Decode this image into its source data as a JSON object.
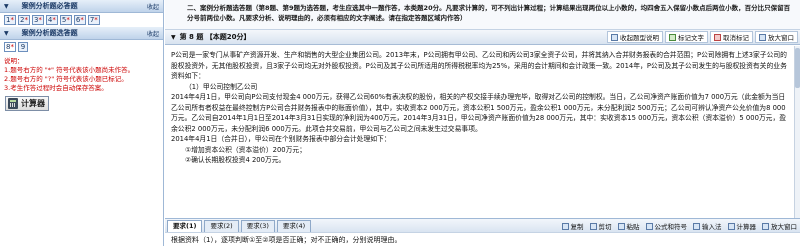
{
  "left": {
    "header1": {
      "label": "案例分析题必答题",
      "collapse": "收起"
    },
    "required_questions": [
      {
        "num": "1",
        "star": "*"
      },
      {
        "num": "2",
        "star": "*"
      },
      {
        "num": "3",
        "star": "*"
      },
      {
        "num": "4",
        "star": "*"
      },
      {
        "num": "5",
        "star": "*"
      },
      {
        "num": "6",
        "star": "*"
      },
      {
        "num": "7",
        "star": "*"
      }
    ],
    "header2": {
      "label": "案例分析题选答题",
      "collapse": "收起"
    },
    "optional_questions": [
      {
        "num": "8",
        "star": "*"
      },
      {
        "num": "9"
      }
    ],
    "notes": [
      "说明：",
      "1.题号右方的 \"*\" 符号代表该小题尚未作答。",
      "2.题号右方的 \"?\" 符号代表该小题已标记。",
      "3.考生作答过程时会自动保存答案。"
    ],
    "calculator": "计算器"
  },
  "instructions": "二、案例分析题选答题（第8题、第9题为选答题，考生应选其中一题作答，本类题20分。凡要求计算的，可不列出计算过程；计算结果出现两位以上小数的，均四舍五入保留小数点后两位小数，百分比只保留百分号前两位小数。凡要求分析、说明理由的，必须有相应的文字阐述。请在指定答题区域内作答）",
  "question_bar": {
    "title": "第 8 题 【本题20分】",
    "buttons": [
      "收起题型说明",
      "标记文字",
      "取消标记",
      "放大窗口"
    ]
  },
  "content": {
    "paragraphs": [
      "P公司是一家专门从事矿产资源开发、生产和销售的大型企业集团公司。2013年末，P公司拥有甲公司、乙公司和丙公司3家全资子公司，并将其纳入合并财务报表的合并范围；P公司除拥有上述3家子公司的股权投资外，无其他股权投资，且3家子公司均无对外股权投资。P公司及其子公司所适用的所得税税率均为25%，采用的会计期间和会计政策一致。2014年，P公司及其子公司发生的与股权投资有关的业务资料如下：",
      "（1）甲公司控制乙公司",
      "2014年4月1日，甲公司向P公司支付现金4 000万元，获得乙公司60%有表决权的股份，相关的产权交接手续办理完毕，取得对乙公司的控制权。当日，乙公司净资产账面价值为7 000万元（此金额为当日乙公司所有者权益在最终控制方P公司合并财务报表中的账面价值），其中，实收资本2 000万元，资本公积1 500万元，盈余公积1 000万元，未分配利润2 500万元；乙公司可辨认净资产公允价值为8 000万元。乙公司自2014年1月1日至2014年3月31日实现的净利润为400万元，2014年3月31日，甲公司净资产账面价值为28 000万元，其中：实收资本15 000万元，资本公积（资本溢价）5 000万元，盈余公积2 000万元，未分配利润6 000万元。此项合并交易前，甲公司与乙公司之间未发生过交易事项。",
      "2014年4月1日（合并日），甲公司在个别财务报表中部分会计处理如下：",
      "①增加资本公积（资本溢价）200万元；",
      "②确认长期股权投资4 200万元。"
    ]
  },
  "answer_tabs": [
    "要求(1)",
    "要求(2)",
    "要求(3)",
    "要求(4)"
  ],
  "answer_toolbar": [
    "复制",
    "剪切",
    "粘贴",
    "公式和符号",
    "输入法",
    "计算器",
    "放大窗口"
  ],
  "answer_text": "根据资料（1），逐项判断①至②项是否正确；对不正确的，分别说明理由。"
}
